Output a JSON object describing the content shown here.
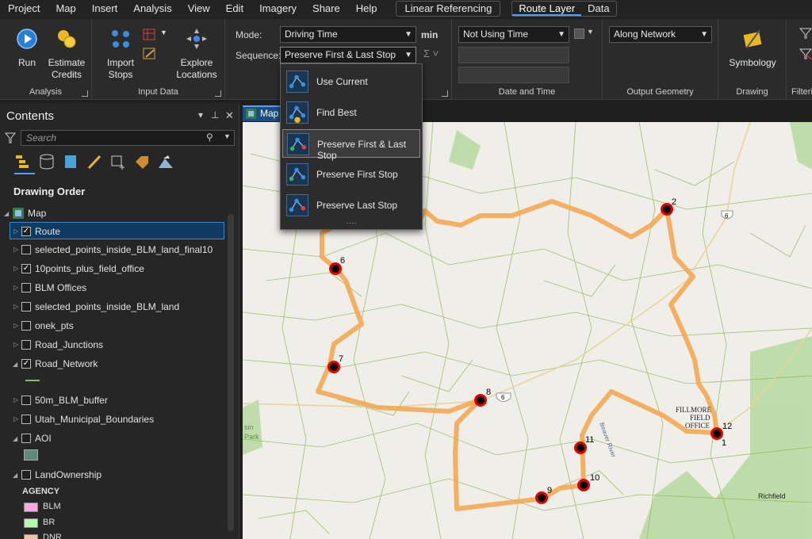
{
  "menu": {
    "items": [
      "Project",
      "Map",
      "Insert",
      "Analysis",
      "View",
      "Edit",
      "Imagery",
      "Share",
      "Help"
    ],
    "context_tab": "Linear Referencing",
    "route_tabs": [
      "Route Layer",
      "Data"
    ]
  },
  "ribbon": {
    "analysis": {
      "run": "Run",
      "estimate_credits": "Estimate Credits",
      "group": "Analysis"
    },
    "input_data": {
      "import_stops": "Import Stops",
      "explore_locations": "Explore Locations",
      "group": "Input Data"
    },
    "travel": {
      "mode_label": "Mode:",
      "mode_value": "Driving Time",
      "unit": "min",
      "sequence_label": "Sequence:",
      "sequence_value": "Preserve First & Last Stop"
    },
    "date_time": {
      "value": "Not Using Time",
      "group": "Date and Time"
    },
    "output_geometry": {
      "value": "Along Network",
      "group": "Output Geometry"
    },
    "drawing": {
      "symbology": "Symbology",
      "group": "Drawing"
    },
    "filtering": {
      "group": "Filteri"
    }
  },
  "sequence_dropdown": {
    "options": [
      "Use Current",
      "Find Best",
      "Preserve First & Last Stop",
      "Preserve First Stop",
      "Preserve Last Stop"
    ],
    "selected": "Preserve First & Last Stop",
    "more": "····"
  },
  "contents": {
    "title": "Contents",
    "search_placeholder": "Search",
    "drawing_order": "Drawing Order",
    "map_name": "Map",
    "layers": [
      {
        "name": "Route",
        "checked": true
      },
      {
        "name": "selected_points_inside_BLM_land_final10",
        "checked": false
      },
      {
        "name": "10points_plus_field_office",
        "checked": true
      },
      {
        "name": "BLM Offices",
        "checked": false
      },
      {
        "name": "selected_points_inside_BLM_land",
        "checked": false
      },
      {
        "name": "onek_pts",
        "checked": false
      },
      {
        "name": "Road_Junctions",
        "checked": false
      },
      {
        "name": "Road_Network",
        "checked": true
      },
      {
        "name": "50m_BLM_buffer",
        "checked": false
      },
      {
        "name": "Utah_Municipal_Boundaries",
        "checked": false
      },
      {
        "name": "AOI",
        "checked": false
      },
      {
        "name": "LandOwnership",
        "checked": false
      }
    ],
    "agency_label": "AGENCY",
    "agencies": [
      {
        "name": "BLM",
        "color": "#f7a8e8"
      },
      {
        "name": "BR",
        "color": "#b6f7b4"
      },
      {
        "name": "DNR",
        "color": "#f5c1a3"
      }
    ],
    "aoi_color": "#5e8a7e"
  },
  "map": {
    "tab": "Map",
    "stops": [
      "2",
      "6",
      "7",
      "8",
      "11",
      "10",
      "9",
      "12",
      "1"
    ],
    "labels": {
      "office": "FILLMORE\nFIELD\nOFFICE",
      "town": "Richfield",
      "hwy1": "6",
      "hwy2": "6",
      "river": "Beaver River",
      "park1": "sin",
      "park2": "Park"
    },
    "colors": {
      "route": "#f5a34a",
      "stop": "#e60000",
      "roads": "#8fb85a",
      "blm": "#b5d9a0"
    }
  }
}
